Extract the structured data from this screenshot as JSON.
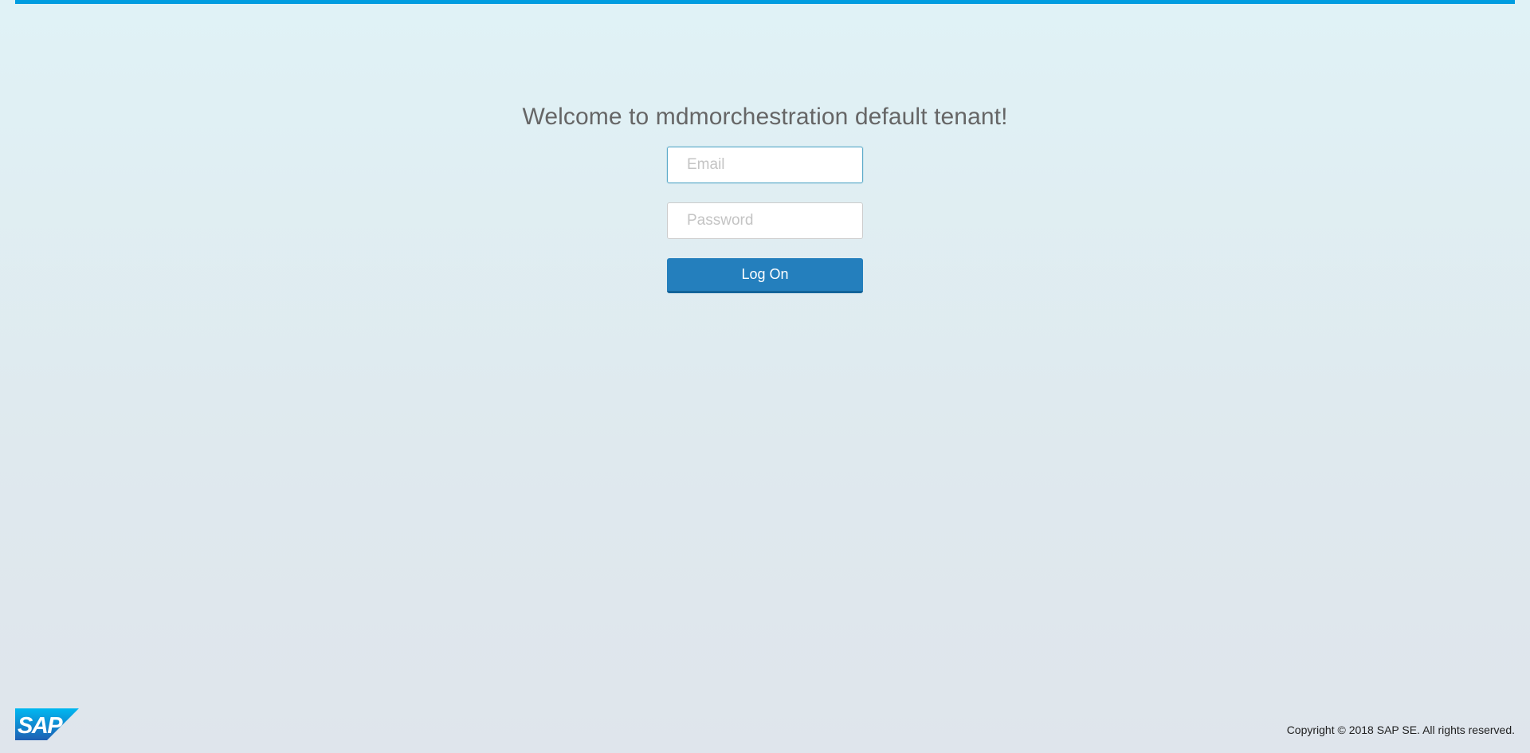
{
  "login": {
    "title": "Welcome to mdmorchestration default tenant!",
    "email_placeholder": "Email",
    "email_value": "",
    "password_placeholder": "Password",
    "password_value": "",
    "logon_label": "Log On",
    "focused_field": "email"
  },
  "footer": {
    "logo_text": "SAP",
    "copyright": "Copyright © 2018 SAP SE. All rights reserved."
  },
  "colors": {
    "top_bar": "#009de0",
    "button": "#247fbd",
    "logo_gradient_top": "#00b8f1",
    "logo_gradient_bottom": "#1e5fb3"
  },
  "icons": {
    "logo": "sap-logo-icon"
  }
}
